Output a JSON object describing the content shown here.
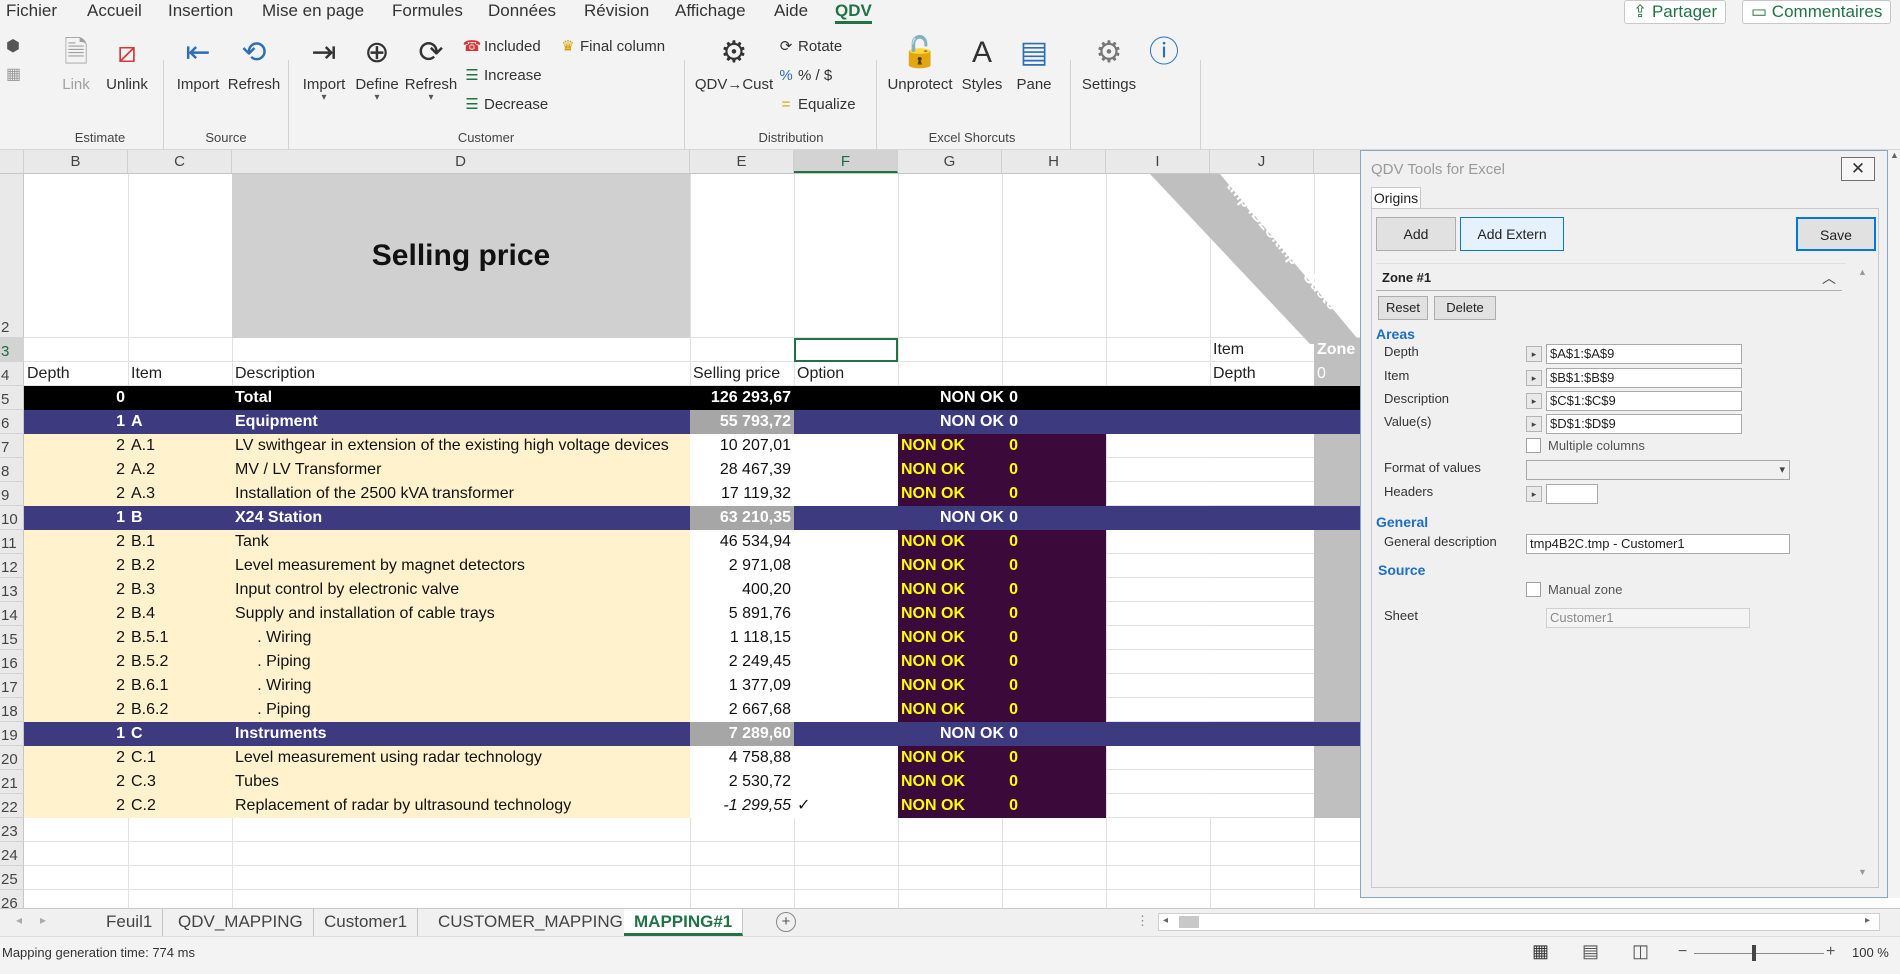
{
  "menu": {
    "items": [
      "Fichier",
      "Accueil",
      "Insertion",
      "Mise en page",
      "Formules",
      "Données",
      "Révision",
      "Affichage",
      "Aide",
      "QDV"
    ],
    "active": "QDV",
    "share": "Partager",
    "comments": "Commentaires"
  },
  "ribbon": {
    "estimate": {
      "label": "Estimate",
      "link": "Link",
      "unlink": "Unlink"
    },
    "source": {
      "label": "Source",
      "import": "Import",
      "refresh": "Refresh"
    },
    "customer": {
      "label": "Customer",
      "import": "Import",
      "define": "Define",
      "refresh": "Refresh",
      "included": "Included",
      "increase": "Increase",
      "decrease": "Decrease",
      "final_column": "Final column"
    },
    "distribution": {
      "label": "Distribution",
      "qdv_cust": "QDV→Cust",
      "rotate": "Rotate",
      "percent": "% / $",
      "equalize": "Equalize"
    },
    "excel": {
      "label": "Excel Shorcuts",
      "unprotect": "Unprotect",
      "styles": "Styles",
      "pane": "Pane"
    },
    "settings": "Settings"
  },
  "grid": {
    "columns": [
      "B",
      "C",
      "D",
      "E",
      "F",
      "G",
      "H",
      "I",
      "J"
    ],
    "row_numbers": [
      "2",
      "3",
      "4",
      "5",
      "6",
      "7",
      "8",
      "9",
      "10",
      "11",
      "12",
      "13",
      "14",
      "15",
      "16",
      "17",
      "18",
      "19",
      "20",
      "21",
      "22",
      "23",
      "24",
      "25",
      "26"
    ],
    "title": "Selling price",
    "rotated_label": "tmp4B2C.tmp - Custo",
    "j3": "Item",
    "k3": "Zone",
    "j4": "Depth",
    "k4": "0",
    "headers": {
      "depth": "Depth",
      "item": "Item",
      "description": "Description",
      "price": "Selling price",
      "option": "Option"
    },
    "rows": [
      {
        "depth": "0",
        "item": "",
        "desc": "Total",
        "price": "126 293,67",
        "status": "NON OK",
        "val": "0",
        "type": "total"
      },
      {
        "depth": "1",
        "item": "A",
        "desc": "Equipment",
        "price": "55 793,72",
        "status": "NON OK",
        "val": "0",
        "type": "group"
      },
      {
        "depth": "2",
        "item": "A.1",
        "desc": "LV swithgear in extension of the existing high voltage devices",
        "price": "10 207,01",
        "status": "NON OK",
        "val": "0",
        "type": "item"
      },
      {
        "depth": "2",
        "item": "A.2",
        "desc": "MV / LV Transformer",
        "price": "28 467,39",
        "status": "NON OK",
        "val": "0",
        "type": "item"
      },
      {
        "depth": "2",
        "item": "A.3",
        "desc": "Installation of the 2500 kVA transformer",
        "price": "17 119,32",
        "status": "NON OK",
        "val": "0",
        "type": "item"
      },
      {
        "depth": "1",
        "item": "B",
        "desc": "X24 Station",
        "price": "63 210,35",
        "status": "NON OK",
        "val": "0",
        "type": "group"
      },
      {
        "depth": "2",
        "item": "B.1",
        "desc": "Tank",
        "price": "46 534,94",
        "status": "NON OK",
        "val": "0",
        "type": "item"
      },
      {
        "depth": "2",
        "item": "B.2",
        "desc": "Level measurement by magnet detectors",
        "price": "2 971,08",
        "status": "NON OK",
        "val": "0",
        "type": "item"
      },
      {
        "depth": "2",
        "item": "B.3",
        "desc": "Input control by electronic valve",
        "price": "400,20",
        "status": "NON OK",
        "val": "0",
        "type": "item"
      },
      {
        "depth": "2",
        "item": "B.4",
        "desc": "Supply and installation of cable trays",
        "price": "5 891,76",
        "status": "NON OK",
        "val": "0",
        "type": "item"
      },
      {
        "depth": "2",
        "item": "B.5.1",
        "desc": "     . Wiring",
        "price": "1 118,15",
        "status": "NON OK",
        "val": "0",
        "type": "item"
      },
      {
        "depth": "2",
        "item": "B.5.2",
        "desc": "     . Piping",
        "price": "2 249,45",
        "status": "NON OK",
        "val": "0",
        "type": "item"
      },
      {
        "depth": "2",
        "item": "B.6.1",
        "desc": "     . Wiring",
        "price": "1 377,09",
        "status": "NON OK",
        "val": "0",
        "type": "item"
      },
      {
        "depth": "2",
        "item": "B.6.2",
        "desc": "     . Piping",
        "price": "2 667,68",
        "status": "NON OK",
        "val": "0",
        "type": "item"
      },
      {
        "depth": "1",
        "item": "C",
        "desc": "Instruments",
        "price": "7 289,60",
        "status": "NON OK",
        "val": "0",
        "type": "group"
      },
      {
        "depth": "2",
        "item": "C.1",
        "desc": "Level measurement using radar technology",
        "price": "4 758,88",
        "status": "NON OK",
        "val": "0",
        "type": "item"
      },
      {
        "depth": "2",
        "item": "C.3",
        "desc": "Tubes",
        "price": "2 530,72",
        "status": "NON OK",
        "val": "0",
        "type": "item"
      },
      {
        "depth": "2",
        "item": "C.2",
        "desc": "Replacement of radar by ultrasound technology",
        "price": "-1 299,55",
        "option": "✓",
        "status": "NON OK",
        "val": "0",
        "type": "item",
        "italic": true
      }
    ]
  },
  "tabs": [
    "Feuil1",
    "QDV_MAPPING",
    "Customer1",
    "CUSTOMER_MAPPING",
    "MAPPING#1"
  ],
  "active_tab": "MAPPING#1",
  "status": {
    "text": "Mapping generation time: 774 ms",
    "zoom": "100 %"
  },
  "pane": {
    "title": "QDV Tools for Excel",
    "tab": "Origins",
    "add": "Add",
    "add_extern": "Add Extern",
    "save": "Save",
    "zone": "Zone #1",
    "reset": "Reset",
    "delete": "Delete",
    "areas": "Areas",
    "fields": [
      {
        "label": "Depth",
        "value": "$A$1:$A$9"
      },
      {
        "label": "Item",
        "value": "$B$1:$B$9"
      },
      {
        "label": "Description",
        "value": "$C$1:$C$9"
      },
      {
        "label": "Value(s)",
        "value": "$D$1:$D$9"
      }
    ],
    "multiple_columns": "Multiple columns",
    "format_of_values": "Format of values",
    "headers": "Headers",
    "general": "General",
    "general_description": "General description",
    "general_description_value": "tmp4B2C.tmp - Customer1",
    "source": "Source",
    "manual_zone": "Manual zone",
    "sheet": "Sheet",
    "sheet_value": "Customer1"
  },
  "colors": {
    "total": "#000000",
    "group": "#3d3a80",
    "item_bg": "#fff2cc",
    "status_bg": "#3b0a3a",
    "status_text": "#ffff00",
    "accent": "#217346"
  }
}
